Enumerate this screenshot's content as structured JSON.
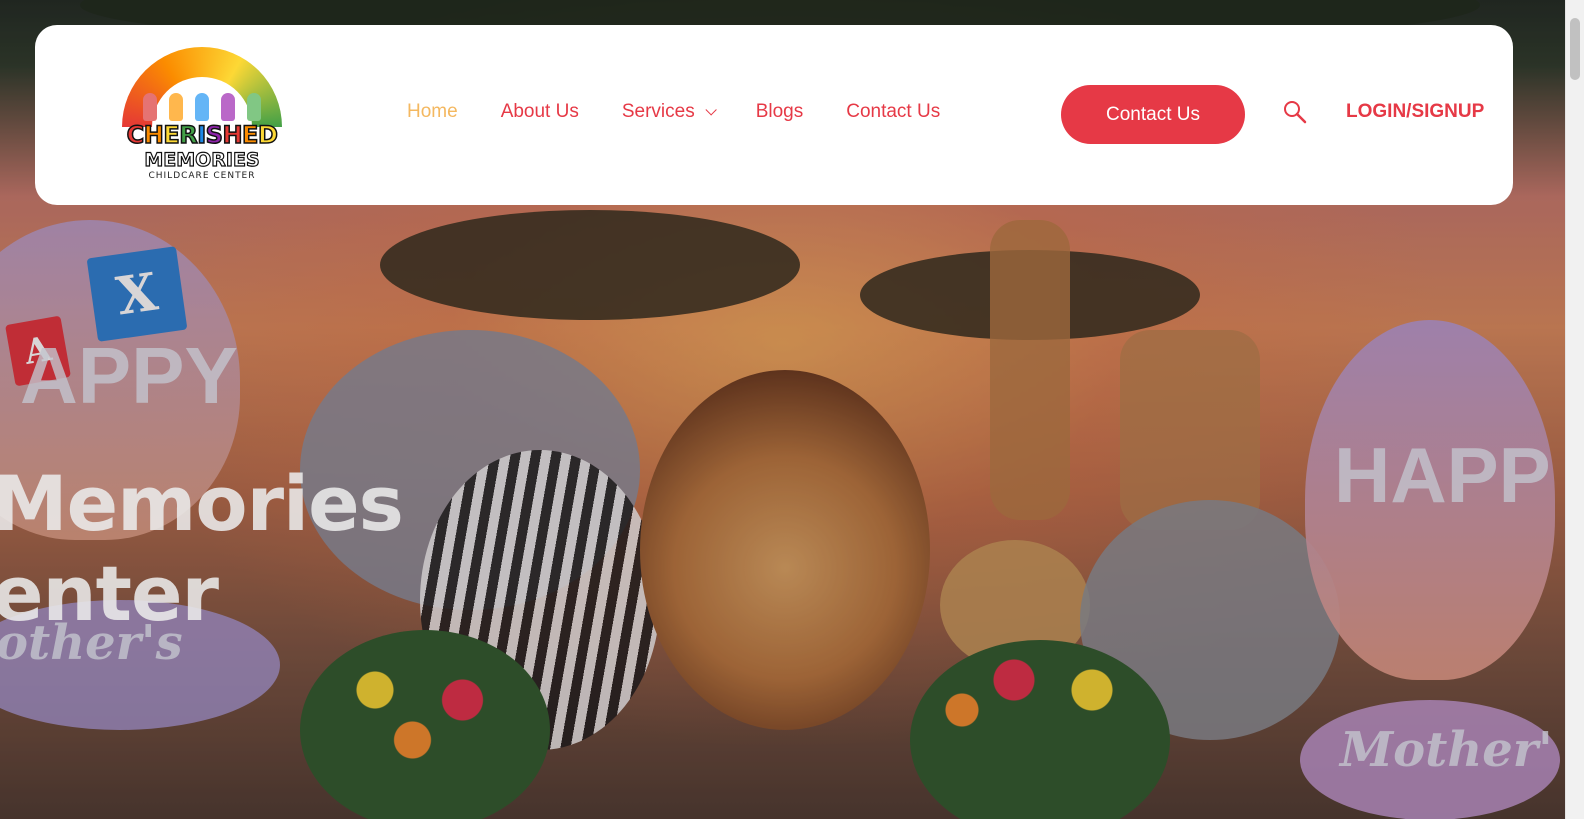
{
  "logo": {
    "line1": "CHERISHED",
    "line2": "MEMORIES",
    "line3": "CHILDCARE CENTER"
  },
  "nav": {
    "items": [
      {
        "label": "Home",
        "active": true
      },
      {
        "label": "About Us"
      },
      {
        "label": "Services",
        "has_dropdown": true
      },
      {
        "label": "Blogs"
      },
      {
        "label": "Contact Us"
      }
    ]
  },
  "header": {
    "cta_label": "Contact Us",
    "login_label": "LOGIN/SIGNUP",
    "search_icon": "search-icon"
  },
  "hero": {
    "title_line1": "Memories",
    "title_line2": "enter",
    "balloon_left_text": "APPY",
    "balloon_right_text": "HAPP",
    "balloon_mothers_left": "other's",
    "balloon_mothers_right": "Mother'",
    "block_x": "X",
    "block_a": "A"
  },
  "colors": {
    "accent": "#e63946",
    "active_nav": "#f4b860",
    "header_bg": "#ffffff"
  }
}
